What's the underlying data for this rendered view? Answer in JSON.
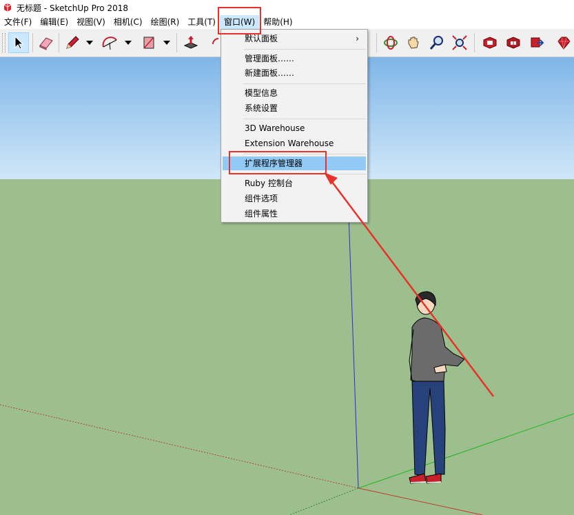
{
  "window": {
    "title": "无标题 - SketchUp Pro 2018",
    "app_icon": "sketchup-logo-icon"
  },
  "menubar": {
    "items": [
      {
        "label": "文件(F)"
      },
      {
        "label": "编辑(E)"
      },
      {
        "label": "视图(V)"
      },
      {
        "label": "相机(C)"
      },
      {
        "label": "绘图(R)"
      },
      {
        "label": "工具(T)"
      },
      {
        "label": "窗口(W)",
        "active": true
      },
      {
        "label": "帮助(H)"
      }
    ]
  },
  "toolbar": {
    "tools": [
      "select-arrow-icon",
      "eraser-icon",
      "pencil-icon",
      "arc-icon",
      "rectangle-icon",
      "push-pull-icon",
      "orbit-icon",
      "pan-hand-icon",
      "zoom-magnifier-icon",
      "zoom-extents-icon",
      "3d-warehouse-icon",
      "extension-warehouse-icon",
      "share-model-icon",
      "ruby-icon"
    ]
  },
  "window_menu": {
    "items": [
      {
        "label": "默认面板",
        "submenu": true
      },
      {
        "label": "管理面板……"
      },
      {
        "label": "新建面板……"
      },
      {
        "label": "模型信息"
      },
      {
        "label": "系统设置"
      },
      {
        "label": "3D Warehouse"
      },
      {
        "label": "Extension Warehouse"
      },
      {
        "label": "扩展程序管理器",
        "highlighted": true
      },
      {
        "label": "Ruby 控制台"
      },
      {
        "label": "组件选项"
      },
      {
        "label": "组件属性"
      }
    ],
    "submenu_arrow": "›"
  },
  "colors": {
    "sky_top": "#7fb6e8",
    "sky_bottom": "#d0e7f8",
    "ground": "#9dbf8e",
    "menu_highlight": "#91c9f7",
    "callout_red": "#e8312a",
    "axis_blue": "#2b2bd0",
    "axis_green": "#1fb51f",
    "axis_red": "#c0392b"
  }
}
